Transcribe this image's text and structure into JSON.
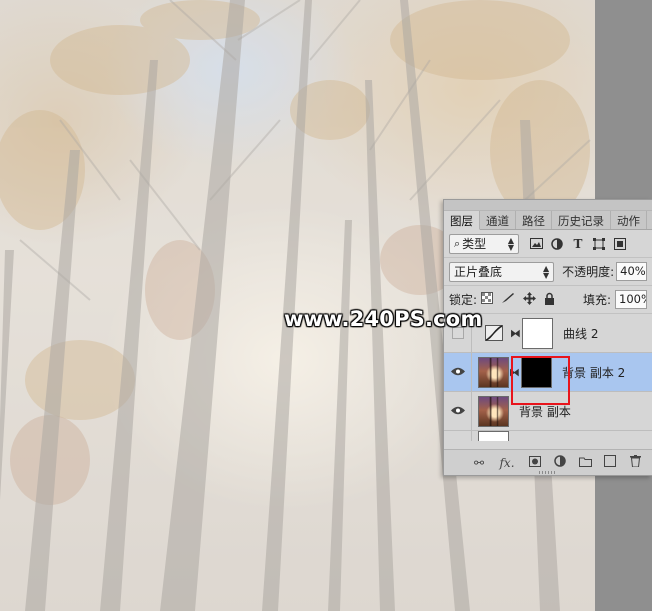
{
  "watermark": "www.240PS.com",
  "layers_panel": {
    "tabs": [
      {
        "label": "图层",
        "active": true
      },
      {
        "label": "通道",
        "active": false
      },
      {
        "label": "路径",
        "active": false
      },
      {
        "label": "历史记录",
        "active": false
      },
      {
        "label": "动作",
        "active": false
      }
    ],
    "filter": {
      "kind_label": "类型",
      "icons": [
        "image-filter-icon",
        "adjustment-filter-icon",
        "type-filter-icon",
        "shape-filter-icon",
        "smart-object-filter-icon"
      ]
    },
    "blend_mode": "正片叠底",
    "opacity_label": "不透明度:",
    "opacity_value": "40%",
    "lock_label": "锁定:",
    "fill_label": "填充:",
    "fill_value": "100%",
    "layers": [
      {
        "name": "曲线 2",
        "visible": false,
        "thumb": "curves-adjustment",
        "mask": "white",
        "selected": false
      },
      {
        "name": "背景 副本 2",
        "visible": true,
        "thumb": "photo",
        "mask": "black",
        "selected": true
      },
      {
        "name": "背景 副本",
        "visible": true,
        "thumb": "photo",
        "mask": "none",
        "selected": false
      }
    ],
    "bottom_icons": [
      "link-icon",
      "fx-icon",
      "add-mask-icon",
      "new-adjustment-icon",
      "new-group-icon",
      "new-layer-icon",
      "delete-icon"
    ],
    "colors": {
      "selected_row": "#a9c6ef",
      "highlight_frame": "#e8141c"
    }
  }
}
